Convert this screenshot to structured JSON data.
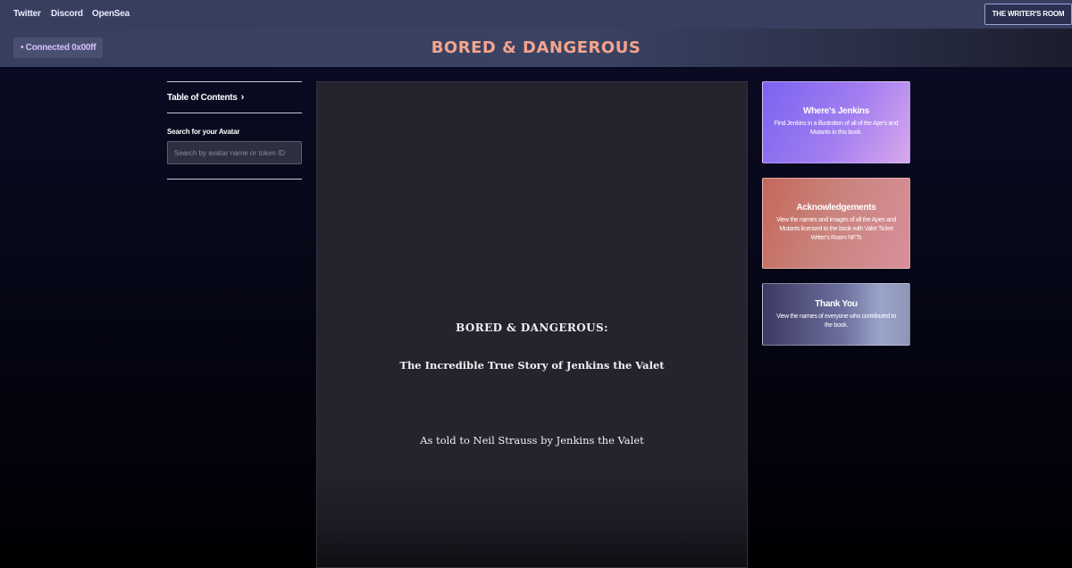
{
  "topnav": {
    "links": [
      "Twitter",
      "Discord",
      "OpenSea"
    ],
    "writers_room_label": "THE WRITER'S ROOM"
  },
  "header": {
    "connected_label": "• Connected 0x00ff",
    "title": "BORED & DANGEROUS"
  },
  "sidebar": {
    "toc_label": "Table of Contents",
    "toc_icon": "chevron-right-icon",
    "search_label": "Search for your Avatar",
    "search_placeholder": "Search by avatar name or token ID",
    "search_value": ""
  },
  "book": {
    "title": "BORED & DANGEROUS:",
    "subtitle": "The Incredible True Story of Jenkins the Valet",
    "byline": "As told to Neil Strauss by Jenkins the Valet"
  },
  "cards": [
    {
      "title": "Where's Jenkins",
      "desc": "Find Jenkins in a illustration of all of the Ape's and Mutants in this book."
    },
    {
      "title": "Acknowledgements",
      "desc": "View the names and images of all the Apes and Mutants licensed to the book with Valet Ticket Writer's Room NFTs"
    },
    {
      "title": "Thank You",
      "desc": "View the names of everyone who contributed to the book."
    }
  ],
  "colors": {
    "title_accent": "#f5a48d",
    "connected_text": "#d8bfff"
  }
}
